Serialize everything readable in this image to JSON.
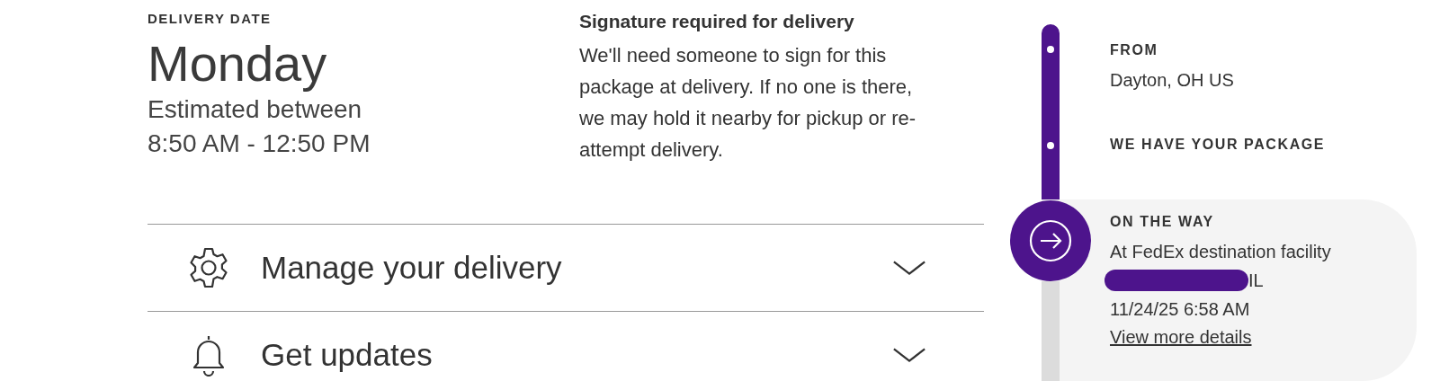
{
  "delivery": {
    "label": "DELIVERY DATE",
    "day": "Monday",
    "estimate_lines": [
      "Estimated between",
      "8:50 AM - 12:50 PM"
    ]
  },
  "signature": {
    "title": "Signature required for delivery",
    "body": "We'll need someone to sign for this package at delivery. If no one is there, we may hold it nearby for pickup or re-attempt delivery."
  },
  "accordions": [
    {
      "kind": "gear",
      "label": "Manage your delivery",
      "expanded": false
    },
    {
      "kind": "bell",
      "label": "Get updates",
      "expanded": false
    }
  ],
  "timeline": [
    {
      "kind": "past",
      "title": "FROM",
      "lines": [
        "Dayton, OH US"
      ]
    },
    {
      "kind": "past",
      "title": "WE HAVE YOUR PACKAGE"
    },
    {
      "kind": "current",
      "title": "ON THE WAY",
      "lines": [
        "At FedEx destination facility"
      ],
      "location": {
        "text": "IL",
        "redacted": true
      },
      "time": "11/24/25 6:58 AM",
      "link": "View more details"
    }
  ]
}
